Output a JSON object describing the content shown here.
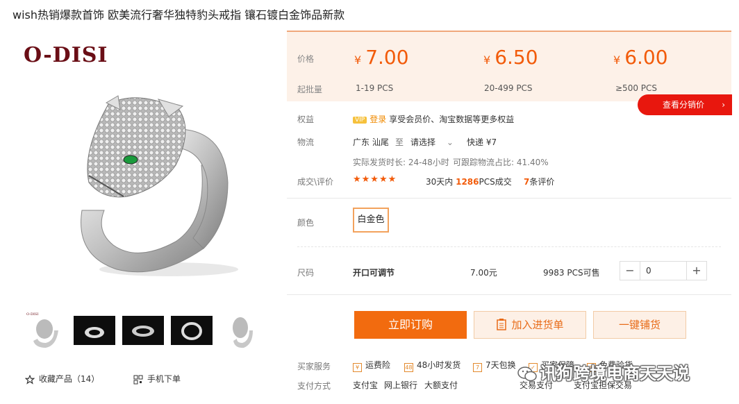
{
  "page": {
    "title": "wish热销爆款首饰 欧美流行奢华独特豹头戒指 镶石镀白金饰品新款"
  },
  "gallery": {
    "brand": "O-DISI",
    "thumbnails": [
      "thumb-1",
      "thumb-2",
      "thumb-3",
      "thumb-4",
      "thumb-5"
    ],
    "favorite_label": "收藏产品（14）",
    "mobile_order_label": "手机下单"
  },
  "pricing": {
    "price_label": "价格",
    "moq_label": "起批量",
    "tiers": [
      {
        "currency": "¥",
        "price": "7.00",
        "range": "1-19 PCS"
      },
      {
        "currency": "¥",
        "price": "6.50",
        "range": "20-499 PCS"
      },
      {
        "currency": "¥",
        "price": "6.00",
        "range": "≥500 PCS"
      }
    ],
    "distribution_button": "查看分销价",
    "accent": "#f25b0a"
  },
  "benefits": {
    "label": "权益",
    "badge": "VIP",
    "login": "登录",
    "text": "享受会员价、淘宝数据等更多权益"
  },
  "logistics": {
    "label": "物流",
    "origin": "广东 汕尾",
    "to": "至",
    "destination_select": "请选择",
    "express": "快递 ¥7",
    "ship_time": "实际发货时长: 24-48小时",
    "trace_ratio": "可跟踪物流占比: 41.40%"
  },
  "reviews": {
    "label": "成交\\评价",
    "stars": "★★★★★",
    "deals_prefix": "30天内",
    "deals_count": "1286",
    "deals_suffix": "PCS成交",
    "review_count": "7",
    "review_suffix": "条评价"
  },
  "color": {
    "label": "颜色",
    "selected": "白金色"
  },
  "size": {
    "label": "尺码",
    "name": "开口可调节",
    "price": "7.00元",
    "stock": "9983 PCS可售",
    "quantity": "0",
    "minus": "−",
    "plus": "+"
  },
  "actions": {
    "order": "立即订购",
    "cart": "加入进货单",
    "distribute": "一键铺货"
  },
  "services": {
    "label": "买家服务",
    "items": [
      {
        "icon": "¥",
        "text": "运费险"
      },
      {
        "icon": "48",
        "text": "48小时发货"
      },
      {
        "icon": "7",
        "text": "7天包换"
      },
      {
        "icon": "✓",
        "text": "买家保障"
      },
      {
        "icon": "$",
        "text": "免费验货"
      }
    ]
  },
  "payment": {
    "label": "支付方式",
    "methods": [
      "支付宝",
      "网上银行",
      "大额支付"
    ],
    "trade_label": "交易支付",
    "trade_value": "支付宝担保交易"
  },
  "watermark": {
    "text": "讯狗跨境电商天天说"
  }
}
